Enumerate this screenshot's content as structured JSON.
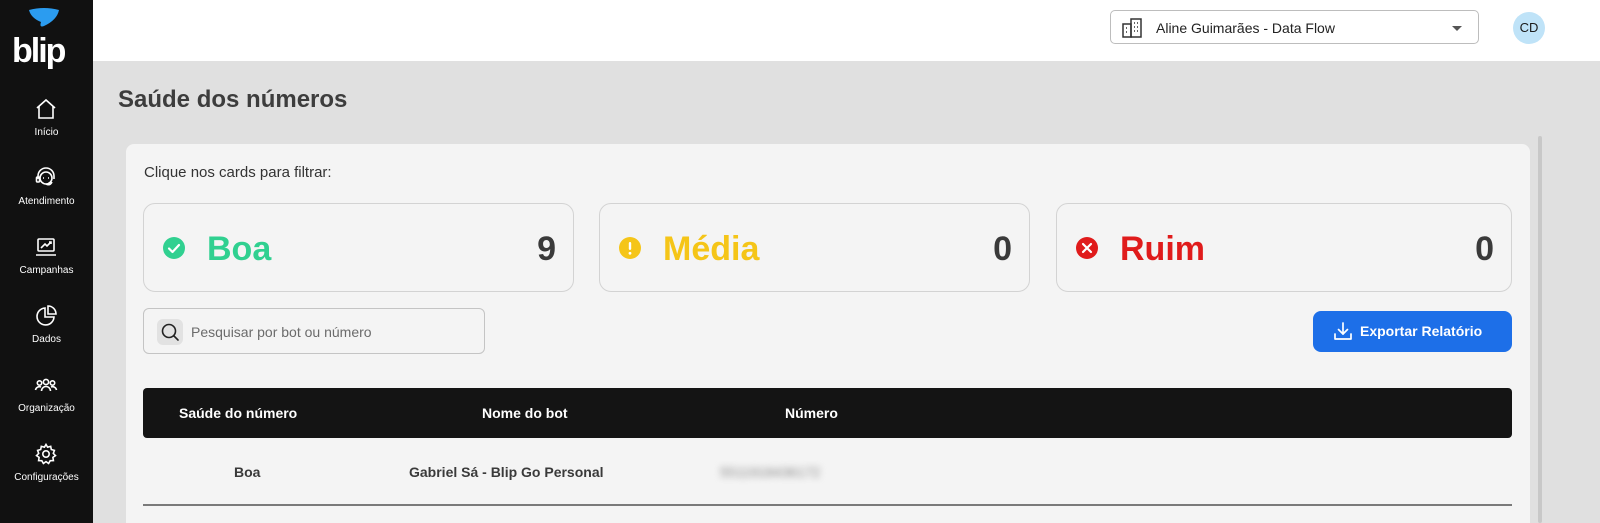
{
  "brand": {
    "logo_text": "blip"
  },
  "sidebar": {
    "items": [
      {
        "label": "Início",
        "icon": "home-icon"
      },
      {
        "label": "Atendimento",
        "icon": "headset-icon"
      },
      {
        "label": "Campanhas",
        "icon": "campaign-icon"
      },
      {
        "label": "Dados",
        "icon": "pie-chart-icon"
      },
      {
        "label": "Organização",
        "icon": "people-icon"
      },
      {
        "label": "Configurações",
        "icon": "gear-icon"
      }
    ]
  },
  "header": {
    "org_name": "Aline Guimarães - Data Flow",
    "org_icon": "building-icon",
    "avatar_initials": "CD"
  },
  "page": {
    "title": "Saúde dos números",
    "filter_hint": "Clique nos cards para filtrar:"
  },
  "cards": [
    {
      "label": "Boa",
      "count": "9",
      "color": "#30d090",
      "icon": "check-circle-icon"
    },
    {
      "label": "Média",
      "count": "0",
      "color": "#f5c518",
      "icon": "warning-circle-icon"
    },
    {
      "label": "Ruim",
      "count": "0",
      "color": "#e01b1b",
      "icon": "x-circle-icon"
    }
  ],
  "search": {
    "placeholder": "Pesquisar por bot ou número",
    "value": ""
  },
  "export_button": {
    "label": "Exportar Relatório",
    "color": "#1d6fe8"
  },
  "table": {
    "columns": [
      "Saúde do número",
      "Nome do bot",
      "Número"
    ],
    "rows": [
      {
        "health": "Boa",
        "bot_name": "Gabriel Sá - Blip Go Personal",
        "number": "5511918436172"
      }
    ]
  }
}
